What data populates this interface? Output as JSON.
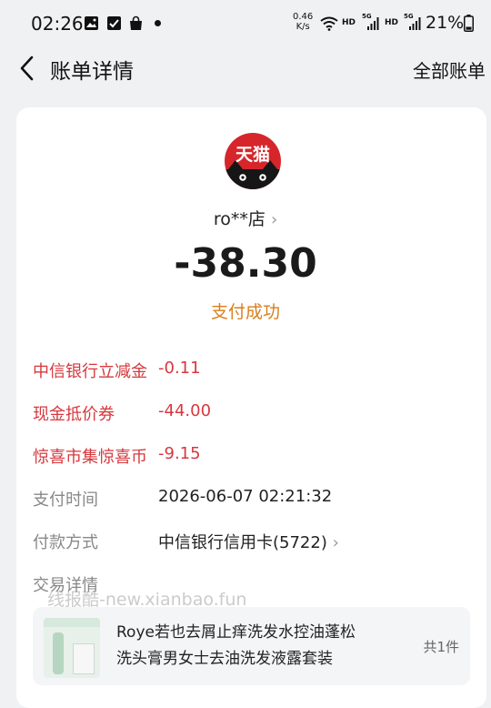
{
  "status_bar": {
    "time": "02:26",
    "net_speed_value": "0.46",
    "net_speed_unit": "K/s",
    "hd1": "HD",
    "net1": "5G",
    "hd2": "HD",
    "net2": "5G",
    "battery": "21%"
  },
  "nav": {
    "title": "账单详情",
    "right_link": "全部账单"
  },
  "merchant": {
    "logo_text": "天猫",
    "name": "ro**店",
    "amount": "-38.30",
    "status": "支付成功"
  },
  "details": [
    {
      "label": "中信银行立减金",
      "value": "-0.11"
    },
    {
      "label": "现金抵价券",
      "value": "-44.00"
    },
    {
      "label": "惊喜市集惊喜币",
      "value": "-9.15"
    },
    {
      "label": "支付时间",
      "value": "2026-06-07 02:21:32"
    },
    {
      "label": "付款方式",
      "value": "中信银行信用卡(5722)"
    },
    {
      "label": "交易详情"
    }
  ],
  "watermark": "线报酷-new.xianbao.fun",
  "product": {
    "title_line1": "Roye若也去屑止痒洗发水控油蓬松",
    "title_line2": "洗头膏男女士去油洗发液露套装",
    "count": "共1件"
  },
  "colors": {
    "accent_red": "#d6383e",
    "status_orange": "#d97f1c",
    "brand_red": "#d6262b"
  }
}
